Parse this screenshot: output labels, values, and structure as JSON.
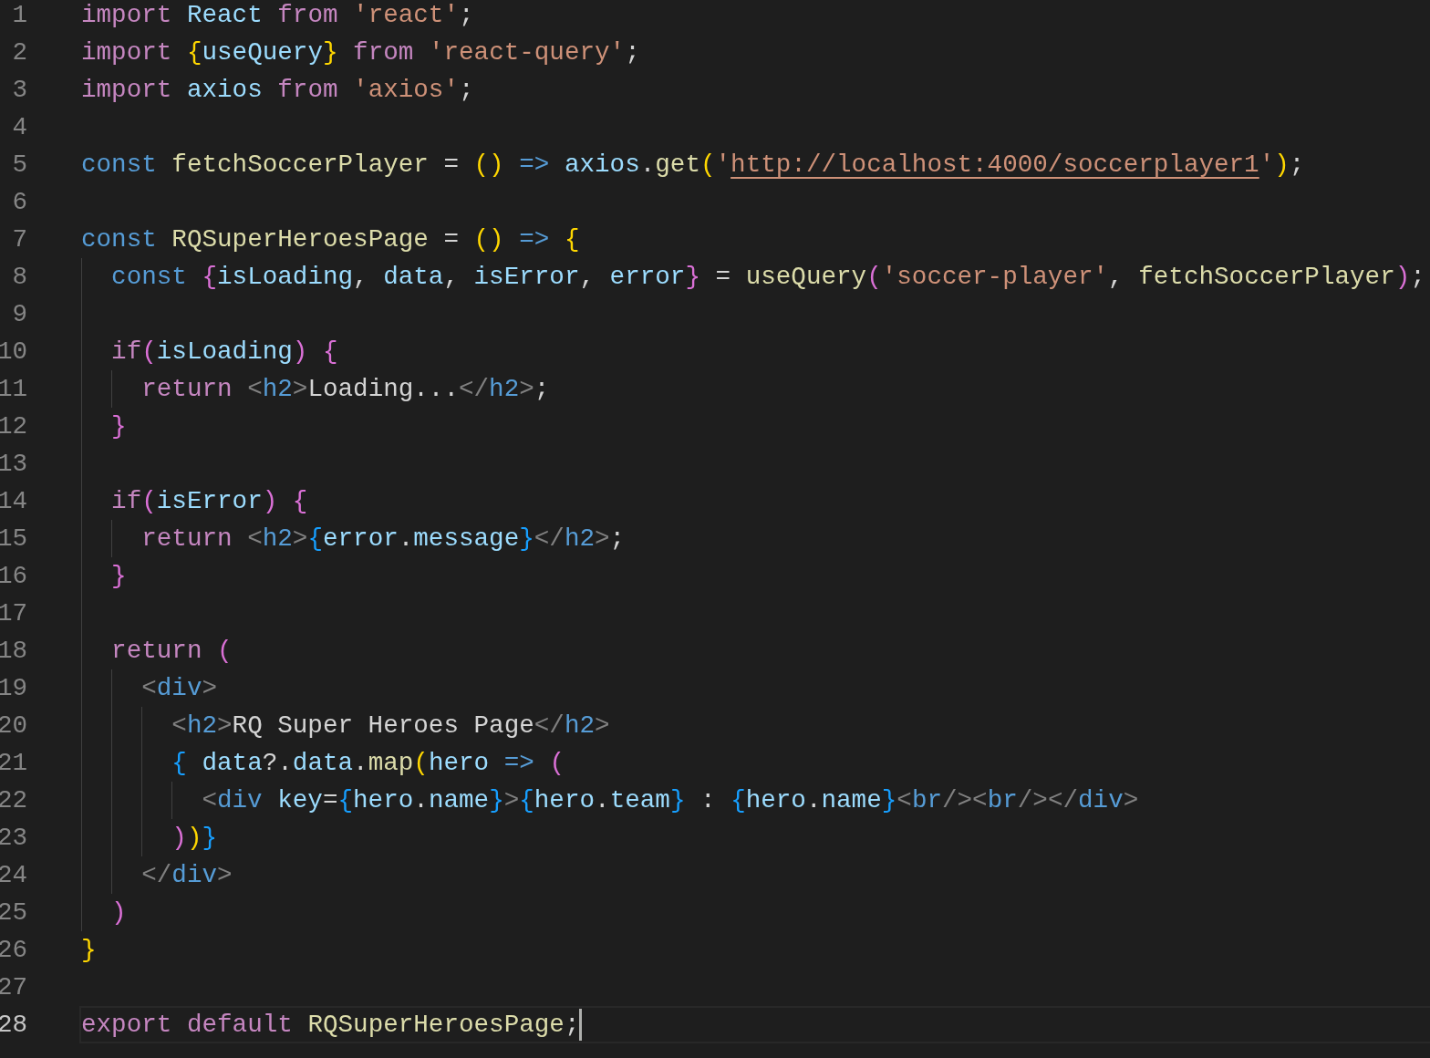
{
  "editor": {
    "lines": [
      {
        "number": "1",
        "tokens": [
          {
            "kind": "keyword",
            "text": "import "
          },
          {
            "kind": "variable",
            "text": "React "
          },
          {
            "kind": "keyword",
            "text": "from "
          },
          {
            "kind": "string",
            "text": "'react'"
          },
          {
            "kind": "plain",
            "text": ";"
          }
        ]
      },
      {
        "number": "2",
        "tokens": [
          {
            "kind": "keyword",
            "text": "import "
          },
          {
            "kind": "bracket1",
            "text": "{"
          },
          {
            "kind": "variable",
            "text": "useQuery"
          },
          {
            "kind": "bracket1",
            "text": "} "
          },
          {
            "kind": "keyword",
            "text": "from "
          },
          {
            "kind": "string",
            "text": "'react-query'"
          },
          {
            "kind": "plain",
            "text": ";"
          }
        ]
      },
      {
        "number": "3",
        "tokens": [
          {
            "kind": "keyword",
            "text": "import "
          },
          {
            "kind": "variable",
            "text": "axios "
          },
          {
            "kind": "keyword",
            "text": "from "
          },
          {
            "kind": "string",
            "text": "'axios'"
          },
          {
            "kind": "plain",
            "text": ";"
          }
        ]
      },
      {
        "number": "4"
      },
      {
        "number": "5",
        "tokens": [
          {
            "kind": "storage",
            "text": "const "
          },
          {
            "kind": "function",
            "text": "fetchSoccerPlayer"
          },
          {
            "kind": "plain",
            "text": " = "
          },
          {
            "kind": "bracket1",
            "text": "() "
          },
          {
            "kind": "storage",
            "text": "=> "
          },
          {
            "kind": "variable",
            "text": "axios"
          },
          {
            "kind": "plain",
            "text": "."
          },
          {
            "kind": "function",
            "text": "get"
          },
          {
            "kind": "bracket1",
            "text": "("
          },
          {
            "kind": "string",
            "text": "'"
          },
          {
            "kind": "link",
            "text": "http://localhost:4000/soccerplayer1"
          },
          {
            "kind": "string",
            "text": "'"
          },
          {
            "kind": "bracket1",
            "text": ")"
          },
          {
            "kind": "plain",
            "text": ";"
          }
        ]
      },
      {
        "number": "6"
      },
      {
        "number": "7",
        "tokens": [
          {
            "kind": "storage",
            "text": "const "
          },
          {
            "kind": "function",
            "text": "RQSuperHeroesPage"
          },
          {
            "kind": "plain",
            "text": " = "
          },
          {
            "kind": "bracket1",
            "text": "() "
          },
          {
            "kind": "storage",
            "text": "=> "
          },
          {
            "kind": "bracket1",
            "text": "{"
          }
        ],
        "children": [
          {
            "number": "8",
            "tokens": [
              {
                "kind": "storage",
                "text": "const "
              },
              {
                "kind": "bracket2",
                "text": "{"
              },
              {
                "kind": "variable",
                "text": "isLoading"
              },
              {
                "kind": "plain",
                "text": ", "
              },
              {
                "kind": "variable",
                "text": "data"
              },
              {
                "kind": "plain",
                "text": ", "
              },
              {
                "kind": "variable",
                "text": "isError"
              },
              {
                "kind": "plain",
                "text": ", "
              },
              {
                "kind": "variable",
                "text": "error"
              },
              {
                "kind": "bracket2",
                "text": "}"
              },
              {
                "kind": "plain",
                "text": " = "
              },
              {
                "kind": "function",
                "text": "useQuery"
              },
              {
                "kind": "bracket2",
                "text": "("
              },
              {
                "kind": "string",
                "text": "'soccer-player'"
              },
              {
                "kind": "plain",
                "text": ", "
              },
              {
                "kind": "function",
                "text": "fetchSoccerPlayer"
              },
              {
                "kind": "bracket2",
                "text": ")"
              },
              {
                "kind": "plain",
                "text": ";"
              }
            ]
          },
          {
            "number": "9"
          },
          {
            "number": "10",
            "tokens": [
              {
                "kind": "keyword",
                "text": "if"
              },
              {
                "kind": "bracket2",
                "text": "("
              },
              {
                "kind": "variable",
                "text": "isLoading"
              },
              {
                "kind": "bracket2",
                "text": ") {"
              }
            ],
            "children": [
              {
                "number": "11",
                "tokens": [
                  {
                    "kind": "keyword",
                    "text": "return "
                  },
                  {
                    "kind": "tag",
                    "text": "<"
                  },
                  {
                    "kind": "tagname",
                    "text": "h2"
                  },
                  {
                    "kind": "tag",
                    "text": ">"
                  },
                  {
                    "kind": "plain",
                    "text": "Loading..."
                  },
                  {
                    "kind": "tag",
                    "text": "</"
                  },
                  {
                    "kind": "tagname",
                    "text": "h2"
                  },
                  {
                    "kind": "tag",
                    "text": ">"
                  },
                  {
                    "kind": "plain",
                    "text": ";"
                  }
                ]
              }
            ]
          },
          {
            "number": "12",
            "tokens": [
              {
                "kind": "bracket2",
                "text": "}"
              }
            ]
          },
          {
            "number": "13"
          },
          {
            "number": "14",
            "tokens": [
              {
                "kind": "keyword",
                "text": "if"
              },
              {
                "kind": "bracket2",
                "text": "("
              },
              {
                "kind": "variable",
                "text": "isError"
              },
              {
                "kind": "bracket2",
                "text": ") {"
              }
            ],
            "children": [
              {
                "number": "15",
                "tokens": [
                  {
                    "kind": "keyword",
                    "text": "return "
                  },
                  {
                    "kind": "tag",
                    "text": "<"
                  },
                  {
                    "kind": "tagname",
                    "text": "h2"
                  },
                  {
                    "kind": "tag",
                    "text": ">"
                  },
                  {
                    "kind": "bracket3",
                    "text": "{"
                  },
                  {
                    "kind": "variable",
                    "text": "error"
                  },
                  {
                    "kind": "plain",
                    "text": "."
                  },
                  {
                    "kind": "variable",
                    "text": "message"
                  },
                  {
                    "kind": "bracket3",
                    "text": "}"
                  },
                  {
                    "kind": "tag",
                    "text": "</"
                  },
                  {
                    "kind": "tagname",
                    "text": "h2"
                  },
                  {
                    "kind": "tag",
                    "text": ">"
                  },
                  {
                    "kind": "plain",
                    "text": ";"
                  }
                ]
              }
            ]
          },
          {
            "number": "16",
            "tokens": [
              {
                "kind": "bracket2",
                "text": "}"
              }
            ]
          },
          {
            "number": "17"
          },
          {
            "number": "18",
            "tokens": [
              {
                "kind": "keyword",
                "text": "return "
              },
              {
                "kind": "bracket2",
                "text": "("
              }
            ],
            "children": [
              {
                "number": "19",
                "tokens": [
                  {
                    "kind": "tag",
                    "text": "<"
                  },
                  {
                    "kind": "tagname",
                    "text": "div"
                  },
                  {
                    "kind": "tag",
                    "text": ">"
                  }
                ],
                "children": [
                  {
                    "number": "20",
                    "tokens": [
                      {
                        "kind": "tag",
                        "text": "<"
                      },
                      {
                        "kind": "tagname",
                        "text": "h2"
                      },
                      {
                        "kind": "tag",
                        "text": ">"
                      },
                      {
                        "kind": "plain",
                        "text": "RQ Super Heroes Page"
                      },
                      {
                        "kind": "tag",
                        "text": "</"
                      },
                      {
                        "kind": "tagname",
                        "text": "h2"
                      },
                      {
                        "kind": "tag",
                        "text": ">"
                      }
                    ]
                  },
                  {
                    "number": "21",
                    "tokens": [
                      {
                        "kind": "bracket3",
                        "text": "{ "
                      },
                      {
                        "kind": "variable",
                        "text": "data"
                      },
                      {
                        "kind": "plain",
                        "text": "?."
                      },
                      {
                        "kind": "variable",
                        "text": "data"
                      },
                      {
                        "kind": "plain",
                        "text": "."
                      },
                      {
                        "kind": "function",
                        "text": "map"
                      },
                      {
                        "kind": "bracket1",
                        "text": "("
                      },
                      {
                        "kind": "variable",
                        "text": "hero "
                      },
                      {
                        "kind": "storage",
                        "text": "=> "
                      },
                      {
                        "kind": "bracket2",
                        "text": "("
                      }
                    ],
                    "children": [
                      {
                        "number": "22",
                        "tokens": [
                          {
                            "kind": "tag",
                            "text": "<"
                          },
                          {
                            "kind": "tagname",
                            "text": "div "
                          },
                          {
                            "kind": "variable",
                            "text": "key"
                          },
                          {
                            "kind": "plain",
                            "text": "="
                          },
                          {
                            "kind": "bracket3",
                            "text": "{"
                          },
                          {
                            "kind": "variable",
                            "text": "hero"
                          },
                          {
                            "kind": "plain",
                            "text": "."
                          },
                          {
                            "kind": "variable",
                            "text": "name"
                          },
                          {
                            "kind": "bracket3",
                            "text": "}"
                          },
                          {
                            "kind": "tag",
                            "text": ">"
                          },
                          {
                            "kind": "bracket3",
                            "text": "{"
                          },
                          {
                            "kind": "variable",
                            "text": "hero"
                          },
                          {
                            "kind": "plain",
                            "text": "."
                          },
                          {
                            "kind": "variable",
                            "text": "team"
                          },
                          {
                            "kind": "bracket3",
                            "text": "}"
                          },
                          {
                            "kind": "plain",
                            "text": " : "
                          },
                          {
                            "kind": "bracket3",
                            "text": "{"
                          },
                          {
                            "kind": "variable",
                            "text": "hero"
                          },
                          {
                            "kind": "plain",
                            "text": "."
                          },
                          {
                            "kind": "variable",
                            "text": "name"
                          },
                          {
                            "kind": "bracket3",
                            "text": "}"
                          },
                          {
                            "kind": "tag",
                            "text": "<"
                          },
                          {
                            "kind": "tagname",
                            "text": "br"
                          },
                          {
                            "kind": "tag",
                            "text": "/><"
                          },
                          {
                            "kind": "tagname",
                            "text": "br"
                          },
                          {
                            "kind": "tag",
                            "text": "/></"
                          },
                          {
                            "kind": "tagname",
                            "text": "div"
                          },
                          {
                            "kind": "tag",
                            "text": ">"
                          }
                        ]
                      }
                    ]
                  },
                  {
                    "number": "23",
                    "tokens": [
                      {
                        "kind": "bracket2",
                        "text": ")"
                      },
                      {
                        "kind": "bracket1",
                        "text": ")"
                      },
                      {
                        "kind": "bracket3",
                        "text": "}"
                      }
                    ]
                  }
                ]
              },
              {
                "number": "24",
                "tokens": [
                  {
                    "kind": "tag",
                    "text": "</"
                  },
                  {
                    "kind": "tagname",
                    "text": "div"
                  },
                  {
                    "kind": "tag",
                    "text": ">"
                  }
                ]
              }
            ]
          },
          {
            "number": "25",
            "tokens": [
              {
                "kind": "bracket2",
                "text": ")"
              }
            ]
          }
        ]
      },
      {
        "number": "26",
        "tokens": [
          {
            "kind": "bracket1",
            "text": "}"
          }
        ]
      },
      {
        "number": "27"
      },
      {
        "number": "28",
        "current": true,
        "tokens": [
          {
            "kind": "keyword",
            "text": "export default "
          },
          {
            "kind": "function",
            "text": "RQSuperHeroesPage"
          },
          {
            "kind": "plain",
            "text": ";"
          }
        ]
      }
    ]
  }
}
